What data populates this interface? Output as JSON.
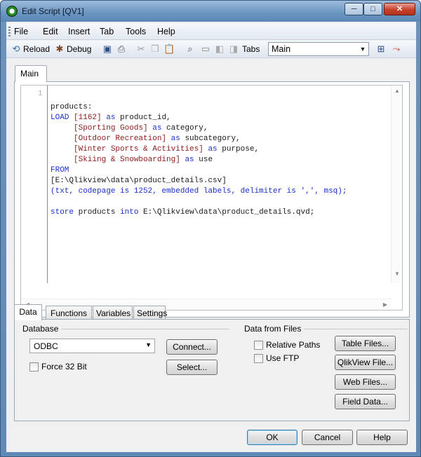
{
  "window": {
    "title": "Edit Script [QV1]",
    "controls": {
      "minimize": "─",
      "maximize": "□",
      "close": "✕"
    }
  },
  "menu": [
    "File",
    "Edit",
    "Insert",
    "Tab",
    "Tools",
    "Help"
  ],
  "toolbar": {
    "reload_label": "Reload",
    "debug_label": "Debug",
    "tabs_label": "Tabs",
    "tab_selected": "Main"
  },
  "script_tabs": [
    "Main"
  ],
  "editor": {
    "line_number": "1",
    "lines": [
      [
        {
          "t": "products:",
          "c": "txt"
        }
      ],
      [
        {
          "t": "LOAD ",
          "c": "kw"
        },
        {
          "t": "[1162]",
          "c": "fld"
        },
        {
          "t": " as ",
          "c": "kw"
        },
        {
          "t": "product_id,",
          "c": "txt"
        }
      ],
      [
        {
          "t": "     [Sporting Goods]",
          "c": "fld"
        },
        {
          "t": " as ",
          "c": "kw"
        },
        {
          "t": "category,",
          "c": "txt"
        }
      ],
      [
        {
          "t": "     [Outdoor Recreation]",
          "c": "fld"
        },
        {
          "t": " as ",
          "c": "kw"
        },
        {
          "t": "subcategory,",
          "c": "txt"
        }
      ],
      [
        {
          "t": "     [Winter Sports & Activities]",
          "c": "fld"
        },
        {
          "t": " as ",
          "c": "kw"
        },
        {
          "t": "purpose,",
          "c": "txt"
        }
      ],
      [
        {
          "t": "     [Skiing & Snowboarding]",
          "c": "fld"
        },
        {
          "t": " as ",
          "c": "kw"
        },
        {
          "t": "use",
          "c": "txt"
        }
      ],
      [
        {
          "t": "FROM",
          "c": "kw"
        }
      ],
      [
        {
          "t": "[E:\\Qlikview\\data\\product_details.csv]",
          "c": "txt"
        }
      ],
      [
        {
          "t": "(txt, codepage is 1252, embedded labels, delimiter is ',', msq);",
          "c": "kw"
        }
      ],
      [
        {
          "t": "",
          "c": "txt"
        }
      ],
      [
        {
          "t": "store ",
          "c": "kw"
        },
        {
          "t": "products ",
          "c": "txt"
        },
        {
          "t": "into ",
          "c": "kw"
        },
        {
          "t": "E:\\Qlikview\\data\\product_details.qvd;",
          "c": "txt"
        }
      ]
    ]
  },
  "bottom_tabs": [
    "Data",
    "Functions",
    "Variables",
    "Settings"
  ],
  "database": {
    "group_label": "Database",
    "selected": "ODBC",
    "connect_label": "Connect...",
    "select_label": "Select...",
    "force32_label": "Force 32 Bit",
    "force32_checked": false
  },
  "files": {
    "group_label": "Data from Files",
    "relative_paths_label": "Relative Paths",
    "relative_paths_checked": false,
    "use_ftp_label": "Use FTP",
    "use_ftp_checked": false,
    "table_files_label": "Table Files...",
    "qlikview_file_label": "QlikView File...",
    "web_files_label": "Web Files...",
    "field_data_label": "Field Data..."
  },
  "dialog": {
    "ok_label": "OK",
    "cancel_label": "Cancel",
    "help_label": "Help"
  },
  "colors": {
    "keyword": "#1a2fcc",
    "field": "#8b1b1b",
    "text": "#1a1a1a"
  }
}
